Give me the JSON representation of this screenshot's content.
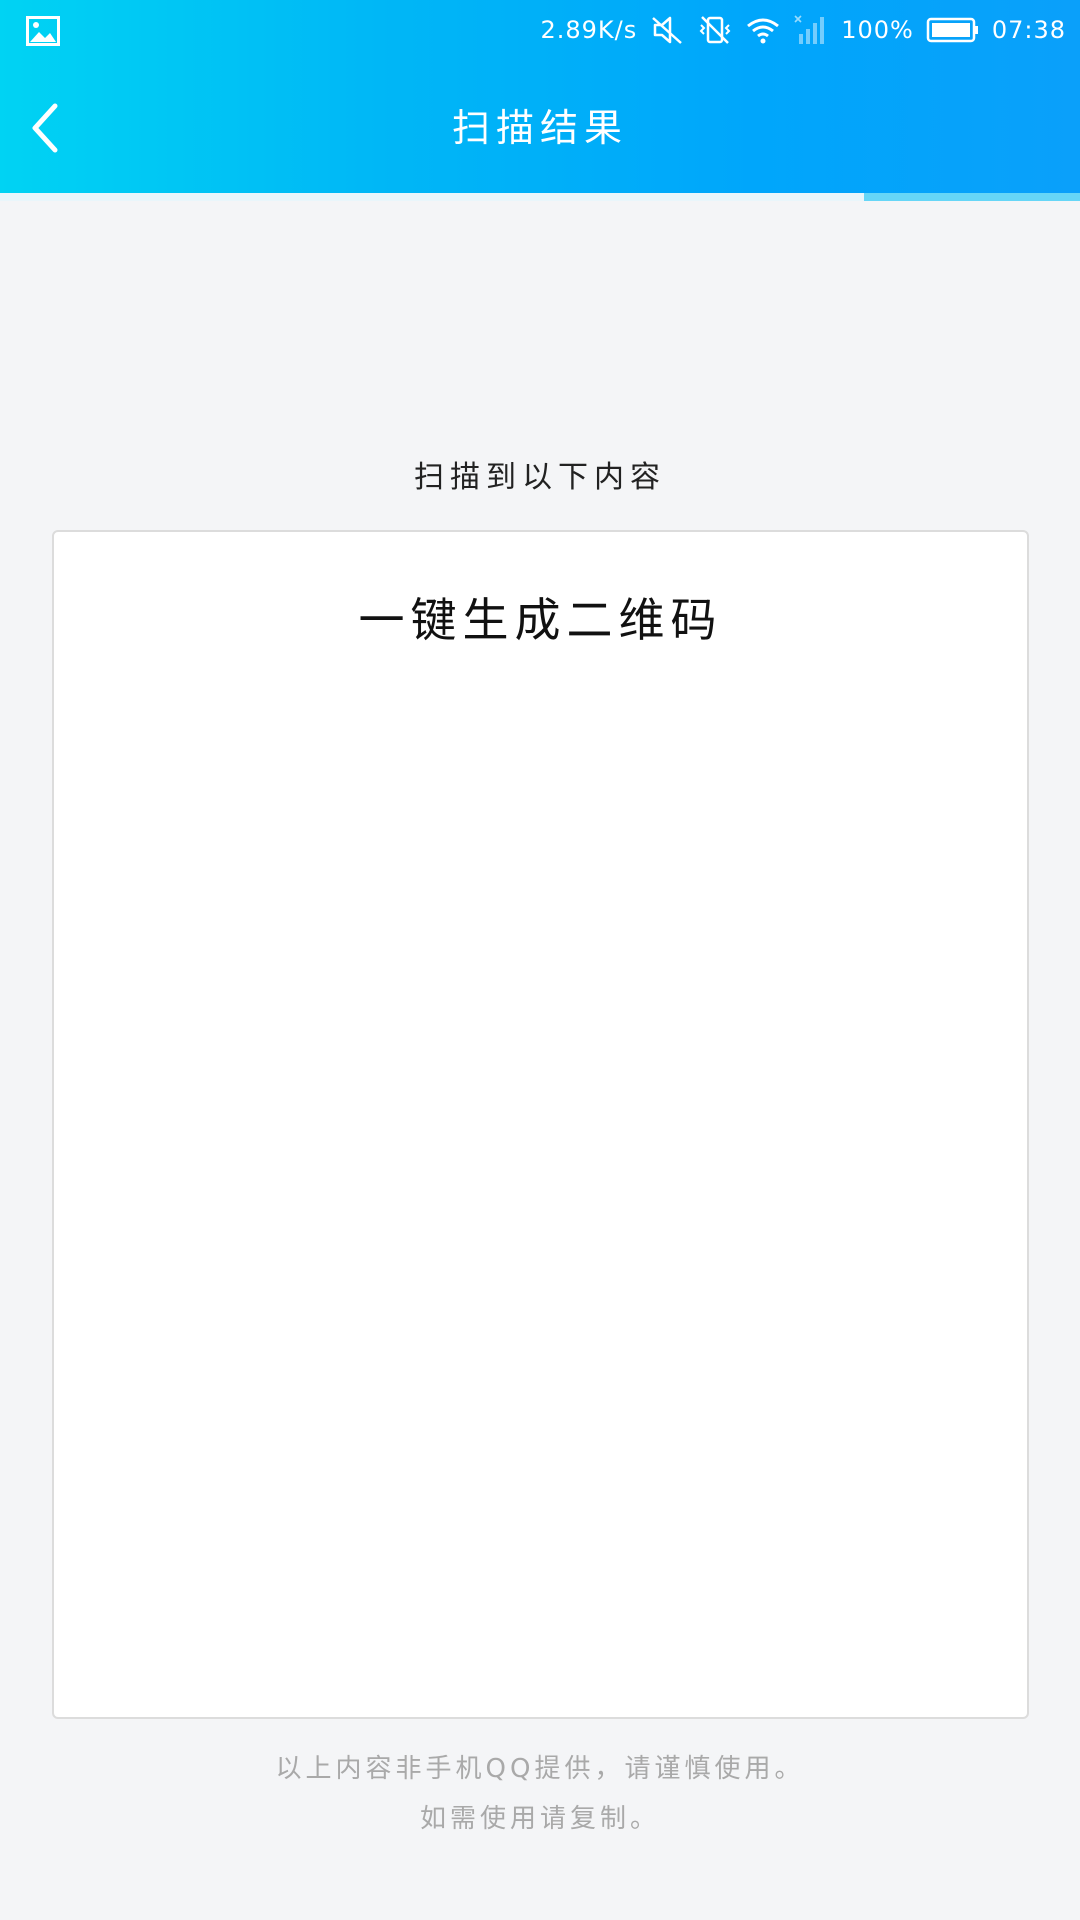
{
  "status_bar": {
    "left_icon": "image-icon",
    "net_speed": "2.89K/s",
    "icons": [
      "mute-icon",
      "vibrate-off-icon",
      "wifi-icon",
      "cell-signal-off-icon"
    ],
    "battery_percent": "100%",
    "time": "07:38"
  },
  "title_bar": {
    "back_icon": "chevron-left-icon",
    "title": "扫描结果"
  },
  "progress": {
    "fraction": 0.8
  },
  "content": {
    "scan_label": "扫描到以下内容",
    "result_text": "一键生成二维码",
    "disclaimer_line1": "以上内容非手机QQ提供，请谨慎使用。",
    "disclaimer_line2": "如需使用请复制。"
  },
  "colors": {
    "header_start": "#00d3f3",
    "header_end": "#0aa0fa",
    "background": "#f4f5f7"
  }
}
